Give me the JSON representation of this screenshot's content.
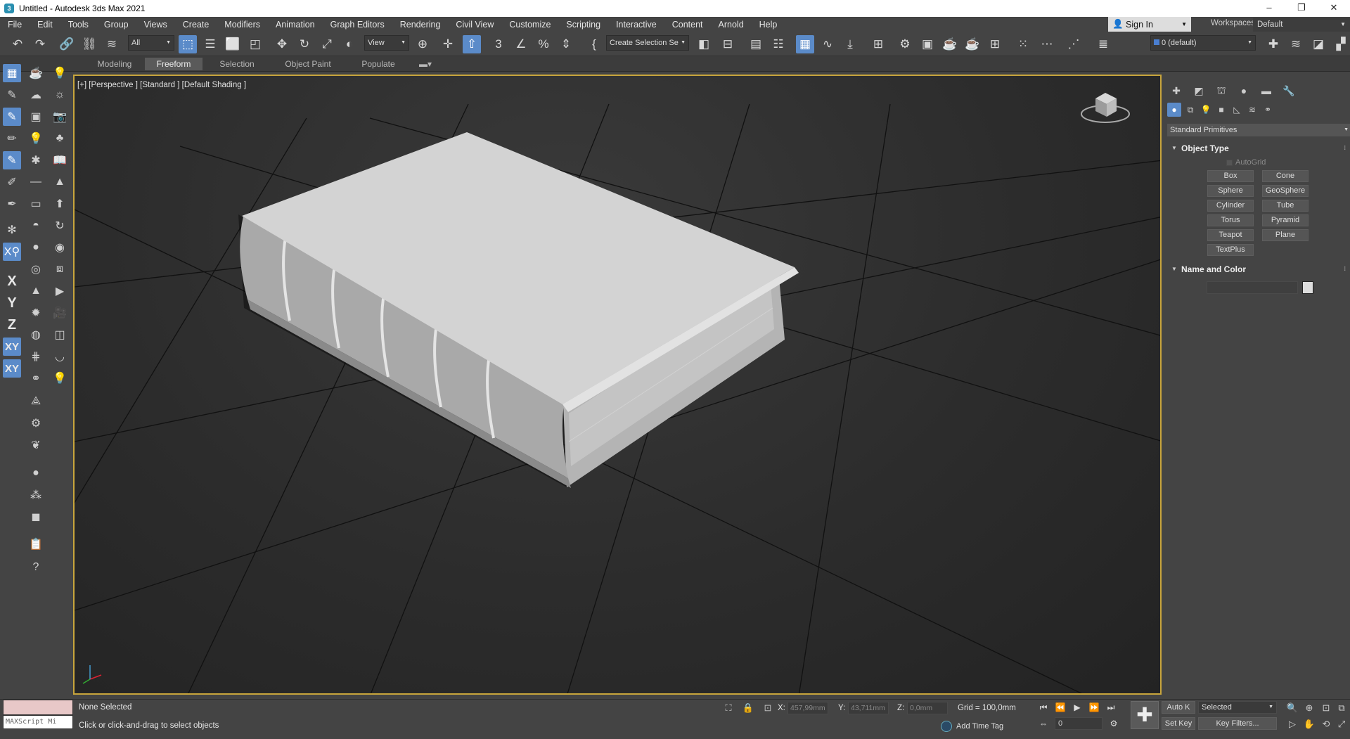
{
  "window": {
    "title": "Untitled - Autodesk 3ds Max 2021",
    "app_icon": "3",
    "controls": {
      "minimize": "–",
      "restore": "❐",
      "close": "✕"
    }
  },
  "menu": [
    "File",
    "Edit",
    "Tools",
    "Group",
    "Views",
    "Create",
    "Modifiers",
    "Animation",
    "Graph Editors",
    "Rendering",
    "Civil View",
    "Customize",
    "Scripting",
    "Interactive",
    "Content",
    "Arnold",
    "Help"
  ],
  "account": {
    "sign_in": "Sign In",
    "workspaces_label": "Workspaces:",
    "workspace": "Default"
  },
  "toolbar": {
    "selection_filter": "All",
    "ref_coord": "View",
    "named_selection": "Create Selection Se",
    "layer": "0 (default)",
    "snap_label": "3",
    "angle_snap": "∠"
  },
  "ribbon": {
    "tabs": [
      "Modeling",
      "Freeform",
      "Selection",
      "Object Paint",
      "Populate"
    ],
    "active": "Freeform"
  },
  "left_toolbar": {
    "axes": [
      "X",
      "Y",
      "Z",
      "XY",
      "XY"
    ]
  },
  "viewport": {
    "label": "[+] [Perspective ] [Standard ] [Default Shading ]",
    "accent": "#c8a53c"
  },
  "command_panel": {
    "category": "Standard Primitives",
    "object_type_title": "Object Type",
    "autogrid": "AutoGrid",
    "primitives": [
      "Box",
      "Cone",
      "Sphere",
      "GeoSphere",
      "Cylinder",
      "Tube",
      "Torus",
      "Pyramid",
      "Teapot",
      "Plane",
      "TextPlus"
    ],
    "name_color_title": "Name and Color"
  },
  "status": {
    "maxscript": "MAXScript Mi",
    "selection": "None Selected",
    "prompt": "Click or click-and-drag to select objects",
    "x_label": "X:",
    "x": "457,99mm",
    "y_label": "Y:",
    "y": "43,711mm",
    "z_label": "Z:",
    "z": "0,0mm",
    "grid": "Grid = 100,0mm",
    "add_time_tag": "Add Time Tag",
    "frame": "0",
    "auto_key": "Auto K",
    "set_key": "Set Key",
    "selected": "Selected",
    "key_filters": "Key Filters..."
  }
}
